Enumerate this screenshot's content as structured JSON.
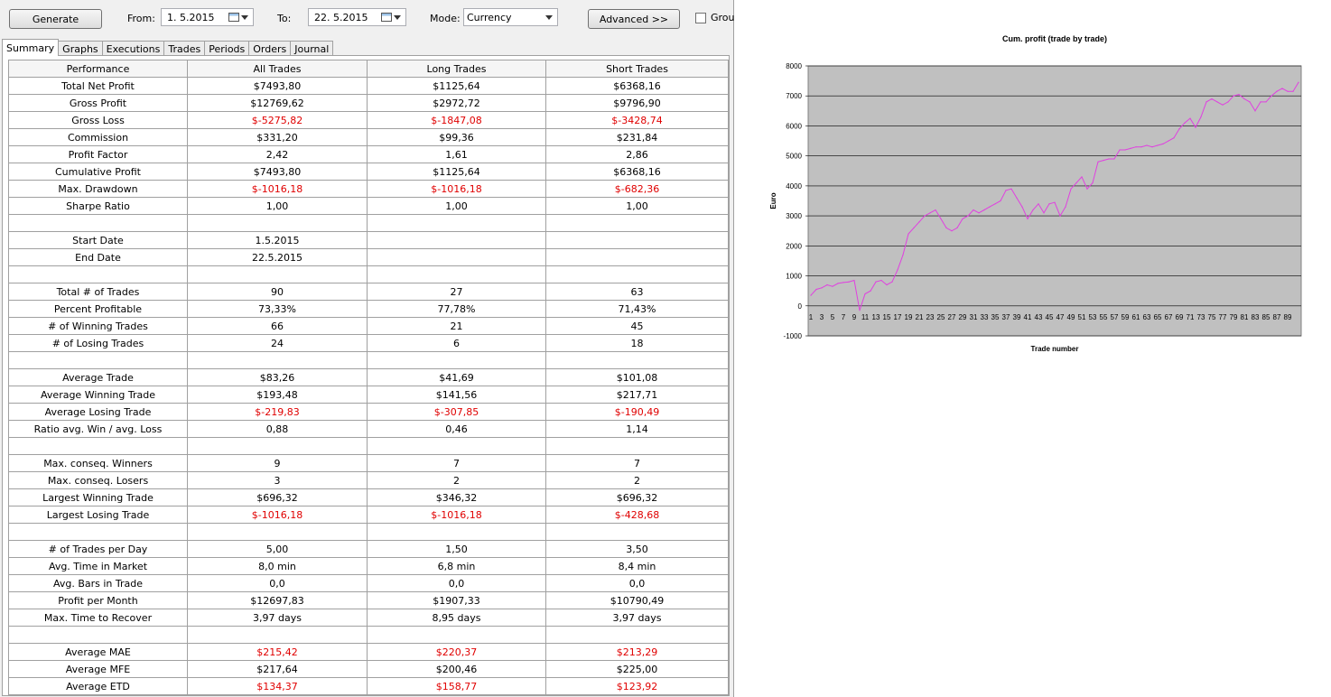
{
  "toolbar": {
    "generate_label": "Generate",
    "from_label": "From:",
    "from_value": "1. 5.2015",
    "to_label": "To:",
    "to_value": "22. 5.2015",
    "mode_label": "Mode:",
    "mode_value": "Currency",
    "advanced_label": "Advanced >>",
    "group_label": "Grou"
  },
  "tabs": [
    "Summary",
    "Graphs",
    "Executions",
    "Trades",
    "Periods",
    "Orders",
    "Journal"
  ],
  "table": {
    "headers": [
      "Performance",
      "All Trades",
      "Long Trades",
      "Short Trades"
    ],
    "rows": [
      {
        "label": "Total Net Profit",
        "all": "$7493,80",
        "long": "$1125,64",
        "short": "$6368,16"
      },
      {
        "label": "Gross Profit",
        "all": "$12769,62",
        "long": "$2972,72",
        "short": "$9796,90"
      },
      {
        "label": "Gross Loss",
        "all": "$-5275,82",
        "long": "$-1847,08",
        "short": "$-3428,74",
        "neg": true
      },
      {
        "label": "Commission",
        "all": "$331,20",
        "long": "$99,36",
        "short": "$231,84"
      },
      {
        "label": "Profit Factor",
        "all": "2,42",
        "long": "1,61",
        "short": "2,86"
      },
      {
        "label": "Cumulative Profit",
        "all": "$7493,80",
        "long": "$1125,64",
        "short": "$6368,16"
      },
      {
        "label": "Max. Drawdown",
        "all": "$-1016,18",
        "long": "$-1016,18",
        "short": "$-682,36",
        "neg": true
      },
      {
        "label": "Sharpe Ratio",
        "all": "1,00",
        "long": "1,00",
        "short": "1,00"
      },
      {
        "label": "",
        "all": "",
        "long": "",
        "short": ""
      },
      {
        "label": "Start Date",
        "all": "1.5.2015",
        "long": "",
        "short": ""
      },
      {
        "label": "End Date",
        "all": "22.5.2015",
        "long": "",
        "short": ""
      },
      {
        "label": "",
        "all": "",
        "long": "",
        "short": ""
      },
      {
        "label": "Total # of Trades",
        "all": "90",
        "long": "27",
        "short": "63"
      },
      {
        "label": "Percent Profitable",
        "all": "73,33%",
        "long": "77,78%",
        "short": "71,43%"
      },
      {
        "label": "# of Winning Trades",
        "all": "66",
        "long": "21",
        "short": "45"
      },
      {
        "label": "# of Losing Trades",
        "all": "24",
        "long": "6",
        "short": "18"
      },
      {
        "label": "",
        "all": "",
        "long": "",
        "short": ""
      },
      {
        "label": "Average Trade",
        "all": "$83,26",
        "long": "$41,69",
        "short": "$101,08"
      },
      {
        "label": "Average Winning Trade",
        "all": "$193,48",
        "long": "$141,56",
        "short": "$217,71"
      },
      {
        "label": "Average Losing Trade",
        "all": "$-219,83",
        "long": "$-307,85",
        "short": "$-190,49",
        "neg": true
      },
      {
        "label": "Ratio avg. Win / avg. Loss",
        "all": "0,88",
        "long": "0,46",
        "short": "1,14"
      },
      {
        "label": "",
        "all": "",
        "long": "",
        "short": ""
      },
      {
        "label": "Max. conseq. Winners",
        "all": "9",
        "long": "7",
        "short": "7"
      },
      {
        "label": "Max. conseq. Losers",
        "all": "3",
        "long": "2",
        "short": "2"
      },
      {
        "label": "Largest Winning Trade",
        "all": "$696,32",
        "long": "$346,32",
        "short": "$696,32"
      },
      {
        "label": "Largest Losing Trade",
        "all": "$-1016,18",
        "long": "$-1016,18",
        "short": "$-428,68",
        "neg": true
      },
      {
        "label": "",
        "all": "",
        "long": "",
        "short": ""
      },
      {
        "label": "# of Trades per Day",
        "all": "5,00",
        "long": "1,50",
        "short": "3,50"
      },
      {
        "label": "Avg. Time in Market",
        "all": "8,0 min",
        "long": "6,8 min",
        "short": "8,4 min"
      },
      {
        "label": "Avg. Bars in Trade",
        "all": "0,0",
        "long": "0,0",
        "short": "0,0"
      },
      {
        "label": "Profit per Month",
        "all": "$12697,83",
        "long": "$1907,33",
        "short": "$10790,49"
      },
      {
        "label": "Max. Time to Recover",
        "all": "3,97 days",
        "long": "8,95 days",
        "short": "3,97 days"
      },
      {
        "label": "",
        "all": "",
        "long": "",
        "short": ""
      },
      {
        "label": "Average MAE",
        "all": "$215,42",
        "long": "$220,37",
        "short": "$213,29",
        "neg": true
      },
      {
        "label": "Average MFE",
        "all": "$217,64",
        "long": "$200,46",
        "short": "$225,00"
      },
      {
        "label": "Average ETD",
        "all": "$134,37",
        "long": "$158,77",
        "short": "$123,92",
        "neg": true
      }
    ]
  },
  "colors": {
    "negative": "#e00000",
    "line": "#e040e0",
    "plot_bg": "#c0c0c0"
  },
  "chart_data": {
    "type": "line",
    "title": "Cum. profit (trade by trade)",
    "xlabel": "Trade number",
    "ylabel": "Euro",
    "ylim": [
      -1000,
      8000
    ],
    "yticks": [
      -1000,
      0,
      1000,
      2000,
      3000,
      4000,
      5000,
      6000,
      7000,
      8000
    ],
    "xticks": [
      1,
      3,
      5,
      7,
      9,
      11,
      13,
      15,
      17,
      19,
      21,
      23,
      25,
      27,
      29,
      31,
      33,
      35,
      37,
      39,
      41,
      43,
      45,
      47,
      49,
      51,
      53,
      55,
      57,
      59,
      61,
      63,
      65,
      67,
      69,
      71,
      73,
      75,
      77,
      79,
      81,
      83,
      85,
      87,
      89
    ],
    "grid": true,
    "series": [
      {
        "values": [
          350,
          550,
          600,
          700,
          650,
          750,
          780,
          800,
          850,
          -150,
          400,
          500,
          800,
          850,
          700,
          800,
          1200,
          1700,
          2400,
          2600,
          2800,
          3000,
          3100,
          3200,
          2900,
          2600,
          2500,
          2600,
          2900,
          3000,
          3200,
          3100,
          3200,
          3300,
          3400,
          3500,
          3850,
          3900,
          3600,
          3300,
          2900,
          3200,
          3400,
          3100,
          3400,
          3450,
          3000,
          3300,
          3900,
          4100,
          4300,
          3900,
          4100,
          4800,
          4850,
          4900,
          4900,
          5200,
          5200,
          5250,
          5300,
          5300,
          5350,
          5300,
          5350,
          5400,
          5500,
          5600,
          5900,
          6100,
          6250,
          5950,
          6300,
          6800,
          6900,
          6800,
          6700,
          6800,
          7000,
          7050,
          6900,
          6800,
          6500,
          6800,
          6800,
          7000,
          7150,
          7250,
          7150,
          7150,
          7450
        ]
      }
    ]
  }
}
